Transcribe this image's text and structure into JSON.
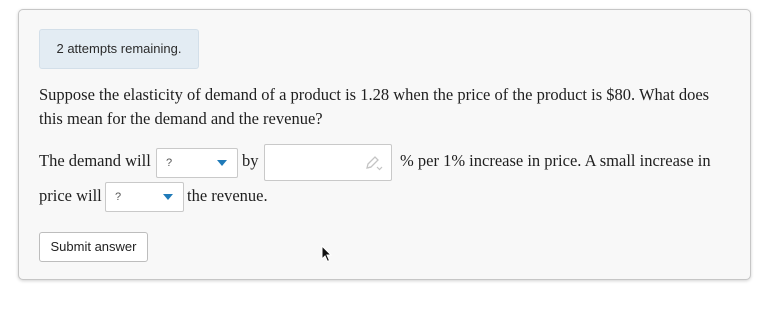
{
  "attempts_text": "2 attempts remaining.",
  "question": "Suppose the elasticity of demand of a product is 1.28 when the price of the product is $80. What does this mean for the demand and the revenue?",
  "sentence": {
    "part1": "The demand will",
    "select1_value": "?",
    "part2": "by",
    "part3": "% per 1% increase in price. A small increase in",
    "part4": "price will",
    "select2_value": "?",
    "part5": "the revenue."
  },
  "submit_label": "Submit answer",
  "colors": {
    "accent": "#1f7ab8",
    "card_bg": "#f8f8f8",
    "attempts_bg": "#e3ecf3"
  },
  "icons": [
    "pencil-icon",
    "chevron-down-icon",
    "mouse-pointer-icon"
  ]
}
